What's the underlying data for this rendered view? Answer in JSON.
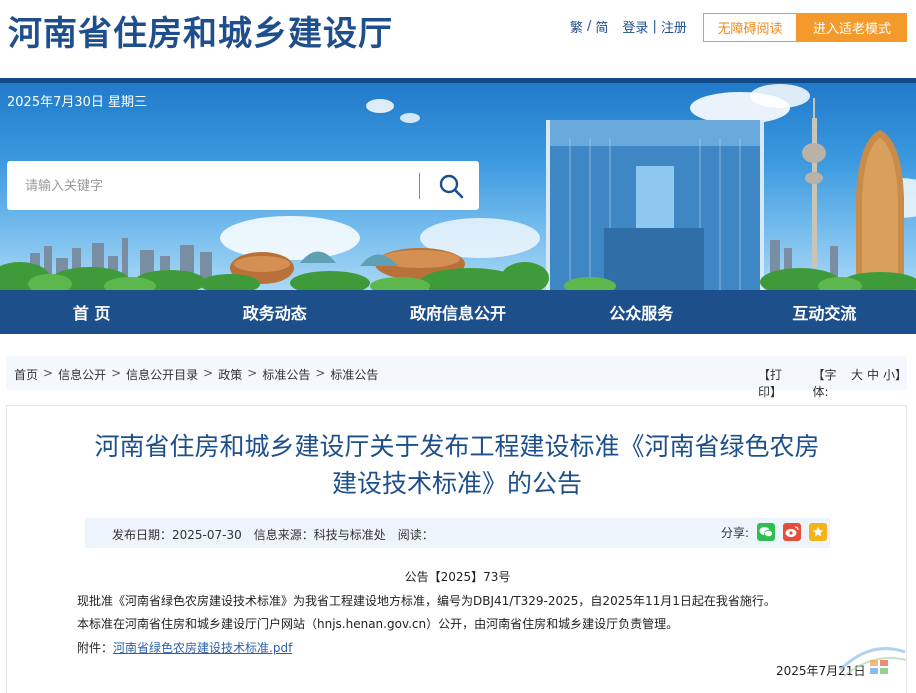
{
  "header": {
    "site_title": "河南省住房和城乡建设厅",
    "lang_trad": "繁",
    "lang_sep": "/",
    "lang_simp": "简",
    "login": "登录",
    "auth_sep": "|",
    "register": "注册",
    "accessible_btn": "无障碍阅读",
    "elder_btn": "进入适老模式",
    "accent_color": "#f39a2a",
    "brand_color": "#1d4f8b"
  },
  "banner": {
    "date": "2025年7月30日 星期三",
    "search_placeholder": "请输入关键字",
    "search_icon": "search-icon"
  },
  "nav": {
    "items": [
      "首 页",
      "政务动态",
      "政府信息公开",
      "公众服务",
      "互动交流"
    ]
  },
  "breadcrumb": {
    "items": [
      "首页",
      "信息公开",
      "信息公开目录",
      "政策",
      "标准公告",
      "标准公告"
    ],
    "separator": ">",
    "print": "【打印】",
    "font_label": "【字体:",
    "font_large": "大",
    "font_medium": "中",
    "font_small": "小】"
  },
  "article": {
    "title_line1": "河南省住房和城乡建设厅关于发布工程建设标准《河南省绿色农房",
    "title_line2": "建设技术标准》的公告",
    "publish_date": "发布日期：2025-07-30",
    "source": "信息来源：科技与标准处",
    "reads": "阅读：",
    "share_label": "分享:",
    "share_icons": [
      "wechat-icon",
      "weibo-icon",
      "favorite-icon"
    ],
    "doc_no": "公告【2025】73号",
    "para1": "现批准《河南省绿色农房建设技术标准》为我省工程建设地方标准，编号为DBJ41/T329-2025，自2025年11月1日起在我省施行。",
    "para2": "本标准在河南省住房和城乡建设厅门户网站（hnjs.henan.gov.cn）公开，由河南省住房和城乡建设厅负责管理。",
    "attachment_label": "附件：",
    "attachment_link": "河南省绿色农房建设技术标准.pdf",
    "sign_date": "2025年7月21日"
  }
}
